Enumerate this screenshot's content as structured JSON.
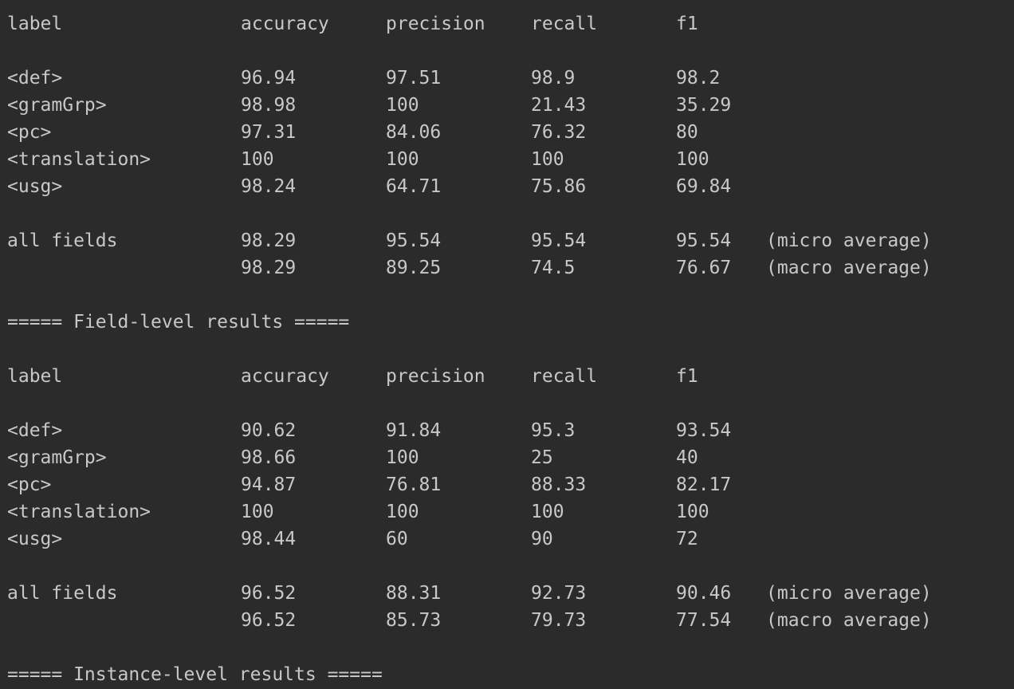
{
  "columns": [
    "label",
    "accuracy",
    "precision",
    "recall",
    "f1"
  ],
  "tables": [
    {
      "rows": [
        [
          "<def>",
          "96.94",
          "97.51",
          "98.9",
          "98.2"
        ],
        [
          "<gramGrp>",
          "98.98",
          "100",
          "21.43",
          "35.29"
        ],
        [
          "<pc>",
          "97.31",
          "84.06",
          "76.32",
          "80"
        ],
        [
          "<translation>",
          "100",
          "100",
          "100",
          "100"
        ],
        [
          "<usg>",
          "98.24",
          "64.71",
          "75.86",
          "69.84"
        ]
      ],
      "summary": [
        {
          "label": "all fields",
          "values": [
            "98.29",
            "95.54",
            "95.54",
            "95.54"
          ],
          "note": "(micro average)"
        },
        {
          "label": "",
          "values": [
            "98.29",
            "89.25",
            "74.5",
            "76.67"
          ],
          "note": "(macro average)"
        }
      ]
    },
    {
      "rows": [
        [
          "<def>",
          "90.62",
          "91.84",
          "95.3",
          "93.54"
        ],
        [
          "<gramGrp>",
          "98.66",
          "100",
          "25",
          "40"
        ],
        [
          "<pc>",
          "94.87",
          "76.81",
          "88.33",
          "82.17"
        ],
        [
          "<translation>",
          "100",
          "100",
          "100",
          "100"
        ],
        [
          "<usg>",
          "98.44",
          "60",
          "90",
          "72"
        ]
      ],
      "summary": [
        {
          "label": "all fields",
          "values": [
            "96.52",
            "88.31",
            "92.73",
            "90.46"
          ],
          "note": "(micro average)"
        },
        {
          "label": "",
          "values": [
            "96.52",
            "85.73",
            "79.73",
            "77.54"
          ],
          "note": "(macro average)"
        }
      ]
    }
  ],
  "headings": [
    "===== Field-level results =====",
    "===== Instance-level results ====="
  ]
}
